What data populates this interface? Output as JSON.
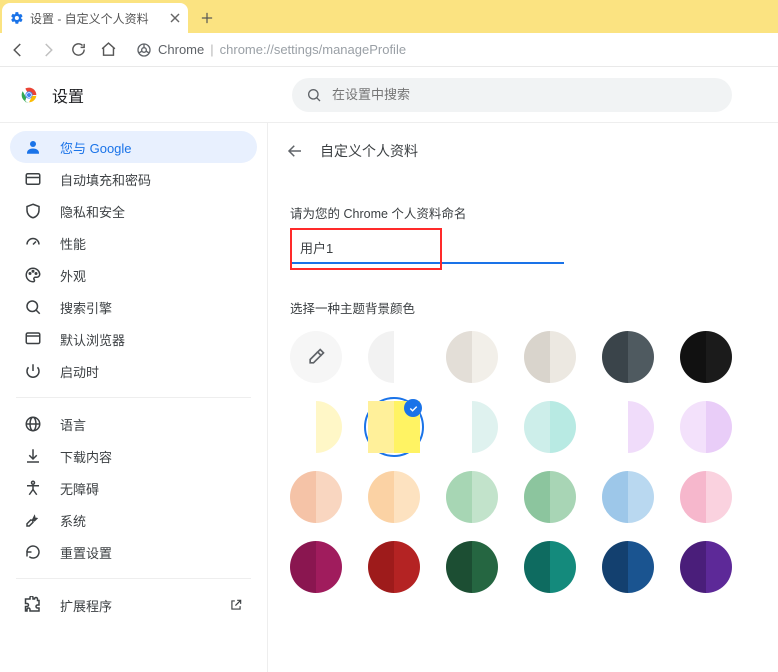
{
  "tab": {
    "title": "设置 - 自定义个人资料"
  },
  "address": {
    "origin": "Chrome",
    "path": "chrome://settings/manageProfile"
  },
  "header": {
    "title": "设置"
  },
  "search": {
    "placeholder": "在设置中搜索"
  },
  "sidebar": {
    "items": [
      {
        "icon": "person",
        "label": "您与 Google",
        "active": true
      },
      {
        "icon": "autofill",
        "label": "自动填充和密码"
      },
      {
        "icon": "shield",
        "label": "隐私和安全"
      },
      {
        "icon": "speed",
        "label": "性能"
      },
      {
        "icon": "palette",
        "label": "外观"
      },
      {
        "icon": "search",
        "label": "搜索引擎"
      },
      {
        "icon": "browser",
        "label": "默认浏览器"
      },
      {
        "icon": "power",
        "label": "启动时"
      }
    ],
    "items2": [
      {
        "icon": "globe",
        "label": "语言"
      },
      {
        "icon": "download",
        "label": "下载内容"
      },
      {
        "icon": "accessibility",
        "label": "无障碍"
      },
      {
        "icon": "wrench",
        "label": "系统"
      },
      {
        "icon": "reset",
        "label": "重置设置"
      }
    ],
    "ext": {
      "icon": "puzzle",
      "label": "扩展程序"
    }
  },
  "content": {
    "title": "自定义个人资料",
    "name_label": "请为您的 Chrome 个人资料命名",
    "name_value": "用户1",
    "theme_label": "选择一种主题背景颜色"
  },
  "palette": [
    {
      "type": "custom"
    },
    {
      "l": "#f2f2f2",
      "r": "#ffffff"
    },
    {
      "l": "#e3ded7",
      "r": "#f2efe9"
    },
    {
      "l": "#d9d4cc",
      "r": "#ece8e1"
    },
    {
      "l": "#3a444a",
      "r": "#4f5a60"
    },
    {
      "l": "#111111",
      "r": "#1b1b1b"
    },
    {
      "l": "#ffffff",
      "r": "#fff7c7"
    },
    {
      "l": "#fff09a",
      "r": "#fff363",
      "selected": true
    },
    {
      "l": "#ffffff",
      "r": "#dff2ef"
    },
    {
      "l": "#cdeeea",
      "r": "#b8eae3"
    },
    {
      "l": "#ffffff",
      "r": "#f0dcfa"
    },
    {
      "l": "#f3e1fb",
      "r": "#e9cdf8"
    },
    {
      "l": "#f5c3a7",
      "r": "#f9d6c0"
    },
    {
      "l": "#fbd2a4",
      "r": "#fde2c0"
    },
    {
      "l": "#a7d6b4",
      "r": "#c2e3cb"
    },
    {
      "l": "#8cc59e",
      "r": "#a8d5b5"
    },
    {
      "l": "#9dc7e9",
      "r": "#b9d8f0"
    },
    {
      "l": "#f6b7cc",
      "r": "#fad2df"
    },
    {
      "l": "#8a1650",
      "r": "#a01c5d"
    },
    {
      "l": "#9e1b1b",
      "r": "#b42323"
    },
    {
      "l": "#1c4e33",
      "r": "#256641"
    },
    {
      "l": "#0e6b60",
      "r": "#148a7c"
    },
    {
      "l": "#13406f",
      "r": "#1a5490"
    },
    {
      "l": "#4a1e7a",
      "r": "#5d2998"
    }
  ]
}
